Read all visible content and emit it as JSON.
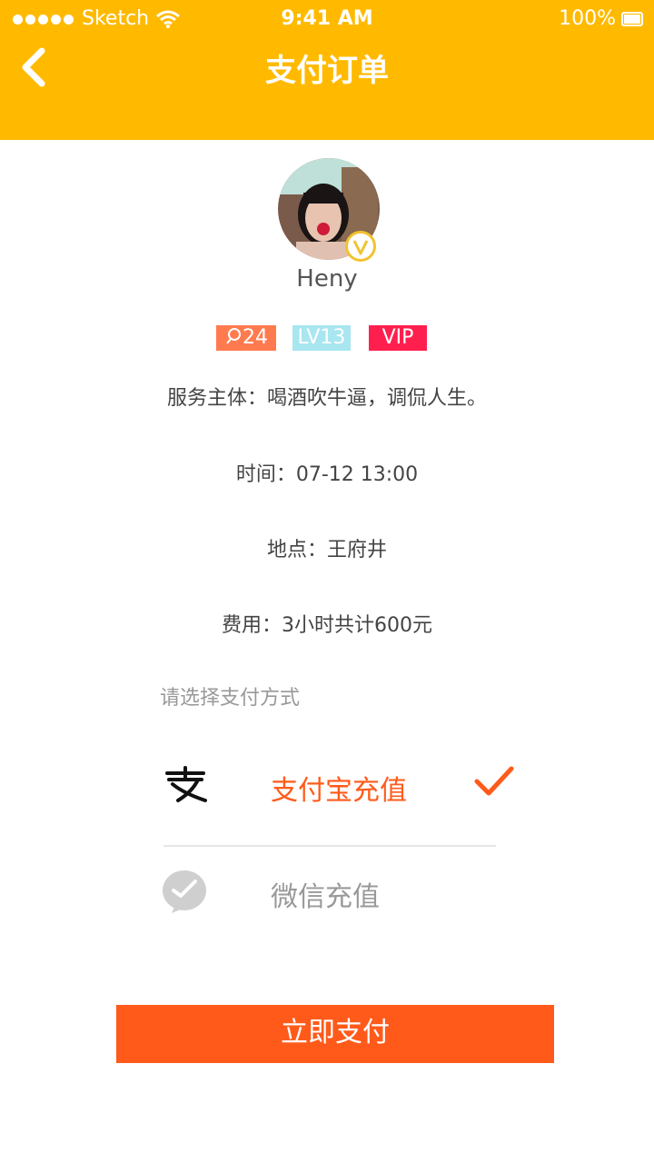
{
  "status_bar": {
    "carrier": "Sketch",
    "time": "9:41 AM",
    "battery": "100%"
  },
  "header": {
    "title": "支付订单",
    "back_icon": "chevron-left-icon",
    "color": "#FFBA00"
  },
  "profile": {
    "name": "Heny",
    "tags": {
      "count": "24",
      "level": "LV13",
      "vip": "VIP"
    }
  },
  "order": {
    "service": "服务主体：喝酒吹牛逼，调侃人生。",
    "time": "时间：07-12 13:00",
    "place": "地点：王府井",
    "cost": "费用：3小时共计600元"
  },
  "payment": {
    "prompt": "请选择支付方式",
    "options": [
      {
        "label": "支付宝充值",
        "icon": "alipay-icon",
        "selected": true,
        "color": "#FF5A1A"
      },
      {
        "label": "微信充值",
        "icon": "wechat-icon",
        "selected": false,
        "color": "#999999"
      }
    ]
  },
  "pay_button": {
    "label": "立即支付",
    "color": "#FF5A1A"
  }
}
